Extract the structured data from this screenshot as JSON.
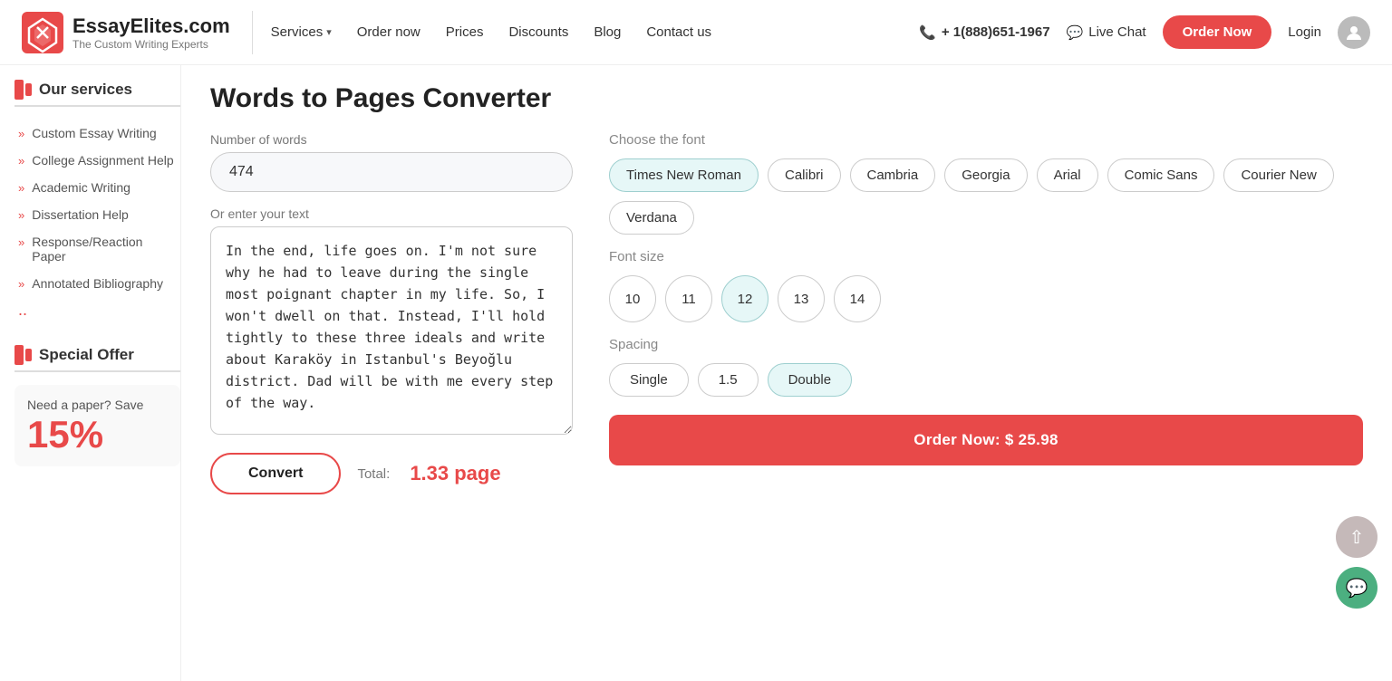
{
  "header": {
    "logo_title": "EssayElites.com",
    "logo_sub": "The Custom Writing Experts",
    "nav": [
      {
        "label": "Services",
        "has_dropdown": true
      },
      {
        "label": "Order now",
        "has_dropdown": false
      },
      {
        "label": "Prices",
        "has_dropdown": false
      },
      {
        "label": "Discounts",
        "has_dropdown": false
      },
      {
        "label": "Blog",
        "has_dropdown": false
      },
      {
        "label": "Contact us",
        "has_dropdown": false
      }
    ],
    "phone": "+ 1(888)651-1967",
    "live_chat": "Live Chat",
    "order_now_btn": "Order Now",
    "login": "Login"
  },
  "sidebar": {
    "our_services_title": "Our services",
    "items": [
      {
        "label": "Custom Essay Writing"
      },
      {
        "label": "College Assignment Help"
      },
      {
        "label": "Academic Writing"
      },
      {
        "label": "Dissertation Help"
      },
      {
        "label": "Response/Reaction Paper"
      },
      {
        "label": "Annotated Bibliography"
      }
    ],
    "more_symbol": ".."
  },
  "special_offer": {
    "title": "Special Offer",
    "description": "Need a paper? Save",
    "percent": "15%"
  },
  "converter": {
    "title": "Words to Pages Converter",
    "number_of_words_label": "Number of words",
    "number_of_words_value": "474",
    "or_enter_text_label": "Or enter your text",
    "text_area_content": "In the end, life goes on. I'm not sure why he had to leave during the single most poignant chapter in my life. So, I won't dwell on that. Instead, I'll hold tightly to these three ideals and write about Karaköy in Istanbul's Beyoğlu district. Dad will be with me every step of the way.",
    "convert_btn": "Convert",
    "total_label": "Total:",
    "total_value": "1.33 page"
  },
  "font_chooser": {
    "label": "Choose the font",
    "fonts": [
      {
        "name": "Times New Roman",
        "selected": true
      },
      {
        "name": "Calibri",
        "selected": false
      },
      {
        "name": "Cambria",
        "selected": false
      },
      {
        "name": "Georgia",
        "selected": false
      },
      {
        "name": "Arial",
        "selected": false
      },
      {
        "name": "Comic Sans",
        "selected": false
      },
      {
        "name": "Courier New",
        "selected": false
      },
      {
        "name": "Verdana",
        "selected": false
      }
    ]
  },
  "font_size": {
    "label": "Font size",
    "sizes": [
      {
        "value": "10",
        "selected": false
      },
      {
        "value": "11",
        "selected": false
      },
      {
        "value": "12",
        "selected": true
      },
      {
        "value": "13",
        "selected": false
      },
      {
        "value": "14",
        "selected": false
      }
    ]
  },
  "spacing": {
    "label": "Spacing",
    "options": [
      {
        "value": "Single",
        "selected": false
      },
      {
        "value": "1.5",
        "selected": false
      },
      {
        "value": "Double",
        "selected": true
      }
    ]
  },
  "order_large": {
    "label": "Order Now: $ 25.98"
  }
}
